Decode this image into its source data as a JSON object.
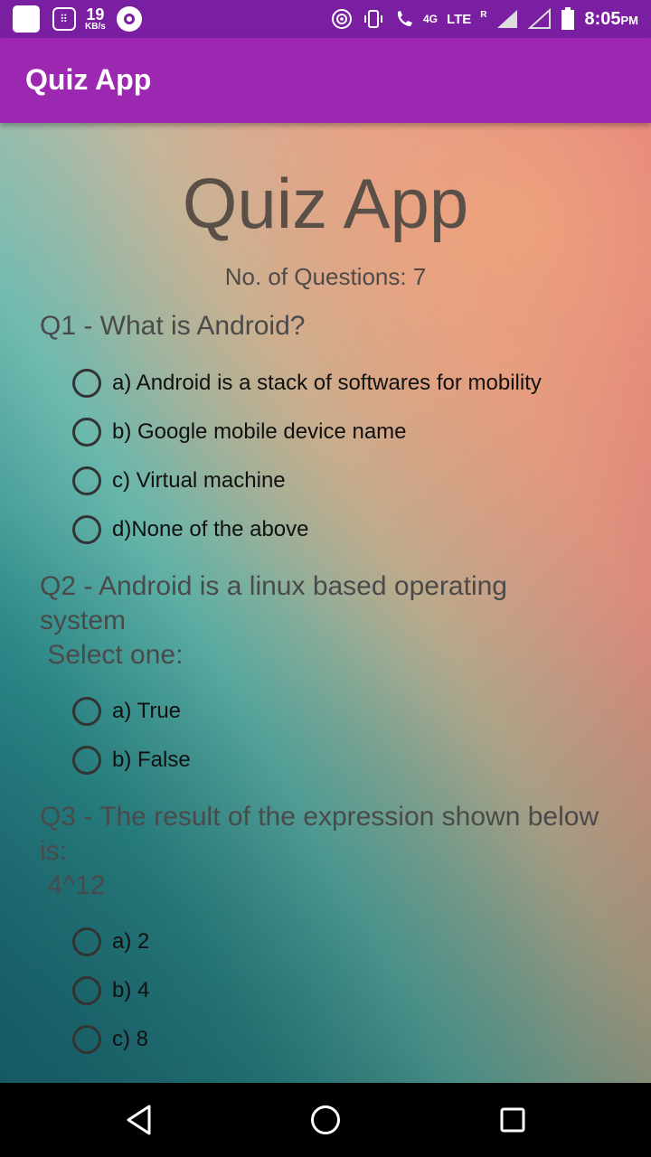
{
  "status_bar": {
    "speed_value": "19",
    "speed_unit": "KB/s",
    "network_type": "4G",
    "lte_label": "LTE",
    "roaming_label": "R",
    "time": "8:05",
    "time_suffix": "PM"
  },
  "app_bar": {
    "title": "Quiz App"
  },
  "main": {
    "title": "Quiz App",
    "question_count": "No. of Questions: 7",
    "questions": [
      {
        "text": "Q1 - What is Android?",
        "options": [
          "a) Android is a stack of softwares for mobility",
          "b) Google mobile device name",
          "c) Virtual machine",
          "d)None of the above"
        ]
      },
      {
        "text": "Q2 - Android is a linux based operating system\n Select one:",
        "options": [
          "a) True",
          "b) False"
        ]
      },
      {
        "text": "Q3 - The result of the expression shown below is:\n 4^12",
        "options": [
          "a) 2",
          "b) 4",
          "c) 8"
        ]
      }
    ]
  },
  "nav_bar": {
    "back_icon": "back-triangle-icon",
    "home_icon": "home-circle-icon",
    "recent_icon": "recent-square-icon"
  },
  "colors": {
    "status_bar": "#7b1fa2",
    "app_bar": "#9c27b0"
  }
}
